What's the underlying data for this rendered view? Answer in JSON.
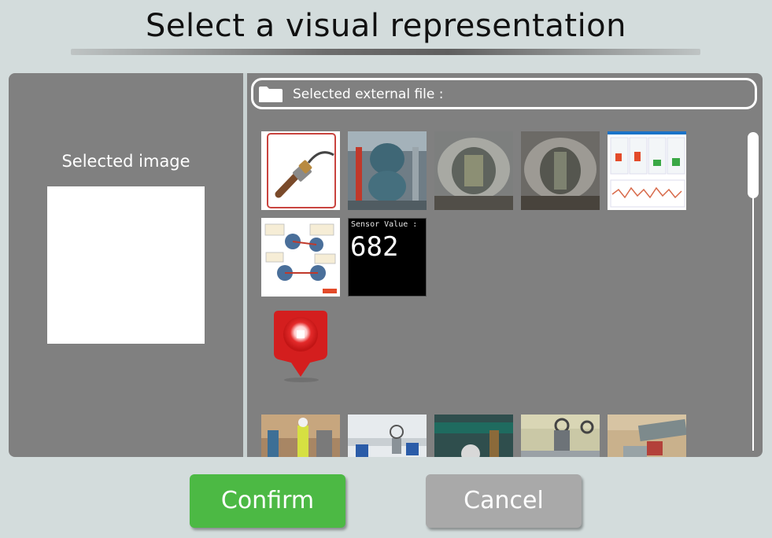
{
  "dialog": {
    "title": "Select a visual representation"
  },
  "left_panel": {
    "selected_label": "Selected image"
  },
  "file_bar": {
    "label": "Selected external file :"
  },
  "thumbnails": {
    "sensor_label": "Sensor Value :",
    "sensor_value": "682"
  },
  "buttons": {
    "confirm": "Confirm",
    "cancel": "Cancel"
  },
  "colors": {
    "panel": "#808080",
    "background": "#d3dcdc",
    "confirm": "#4cb944",
    "cancel": "#a9a9a9"
  },
  "icons": {
    "file_bar": "folder-icon",
    "marker": "map-pin-icon"
  }
}
